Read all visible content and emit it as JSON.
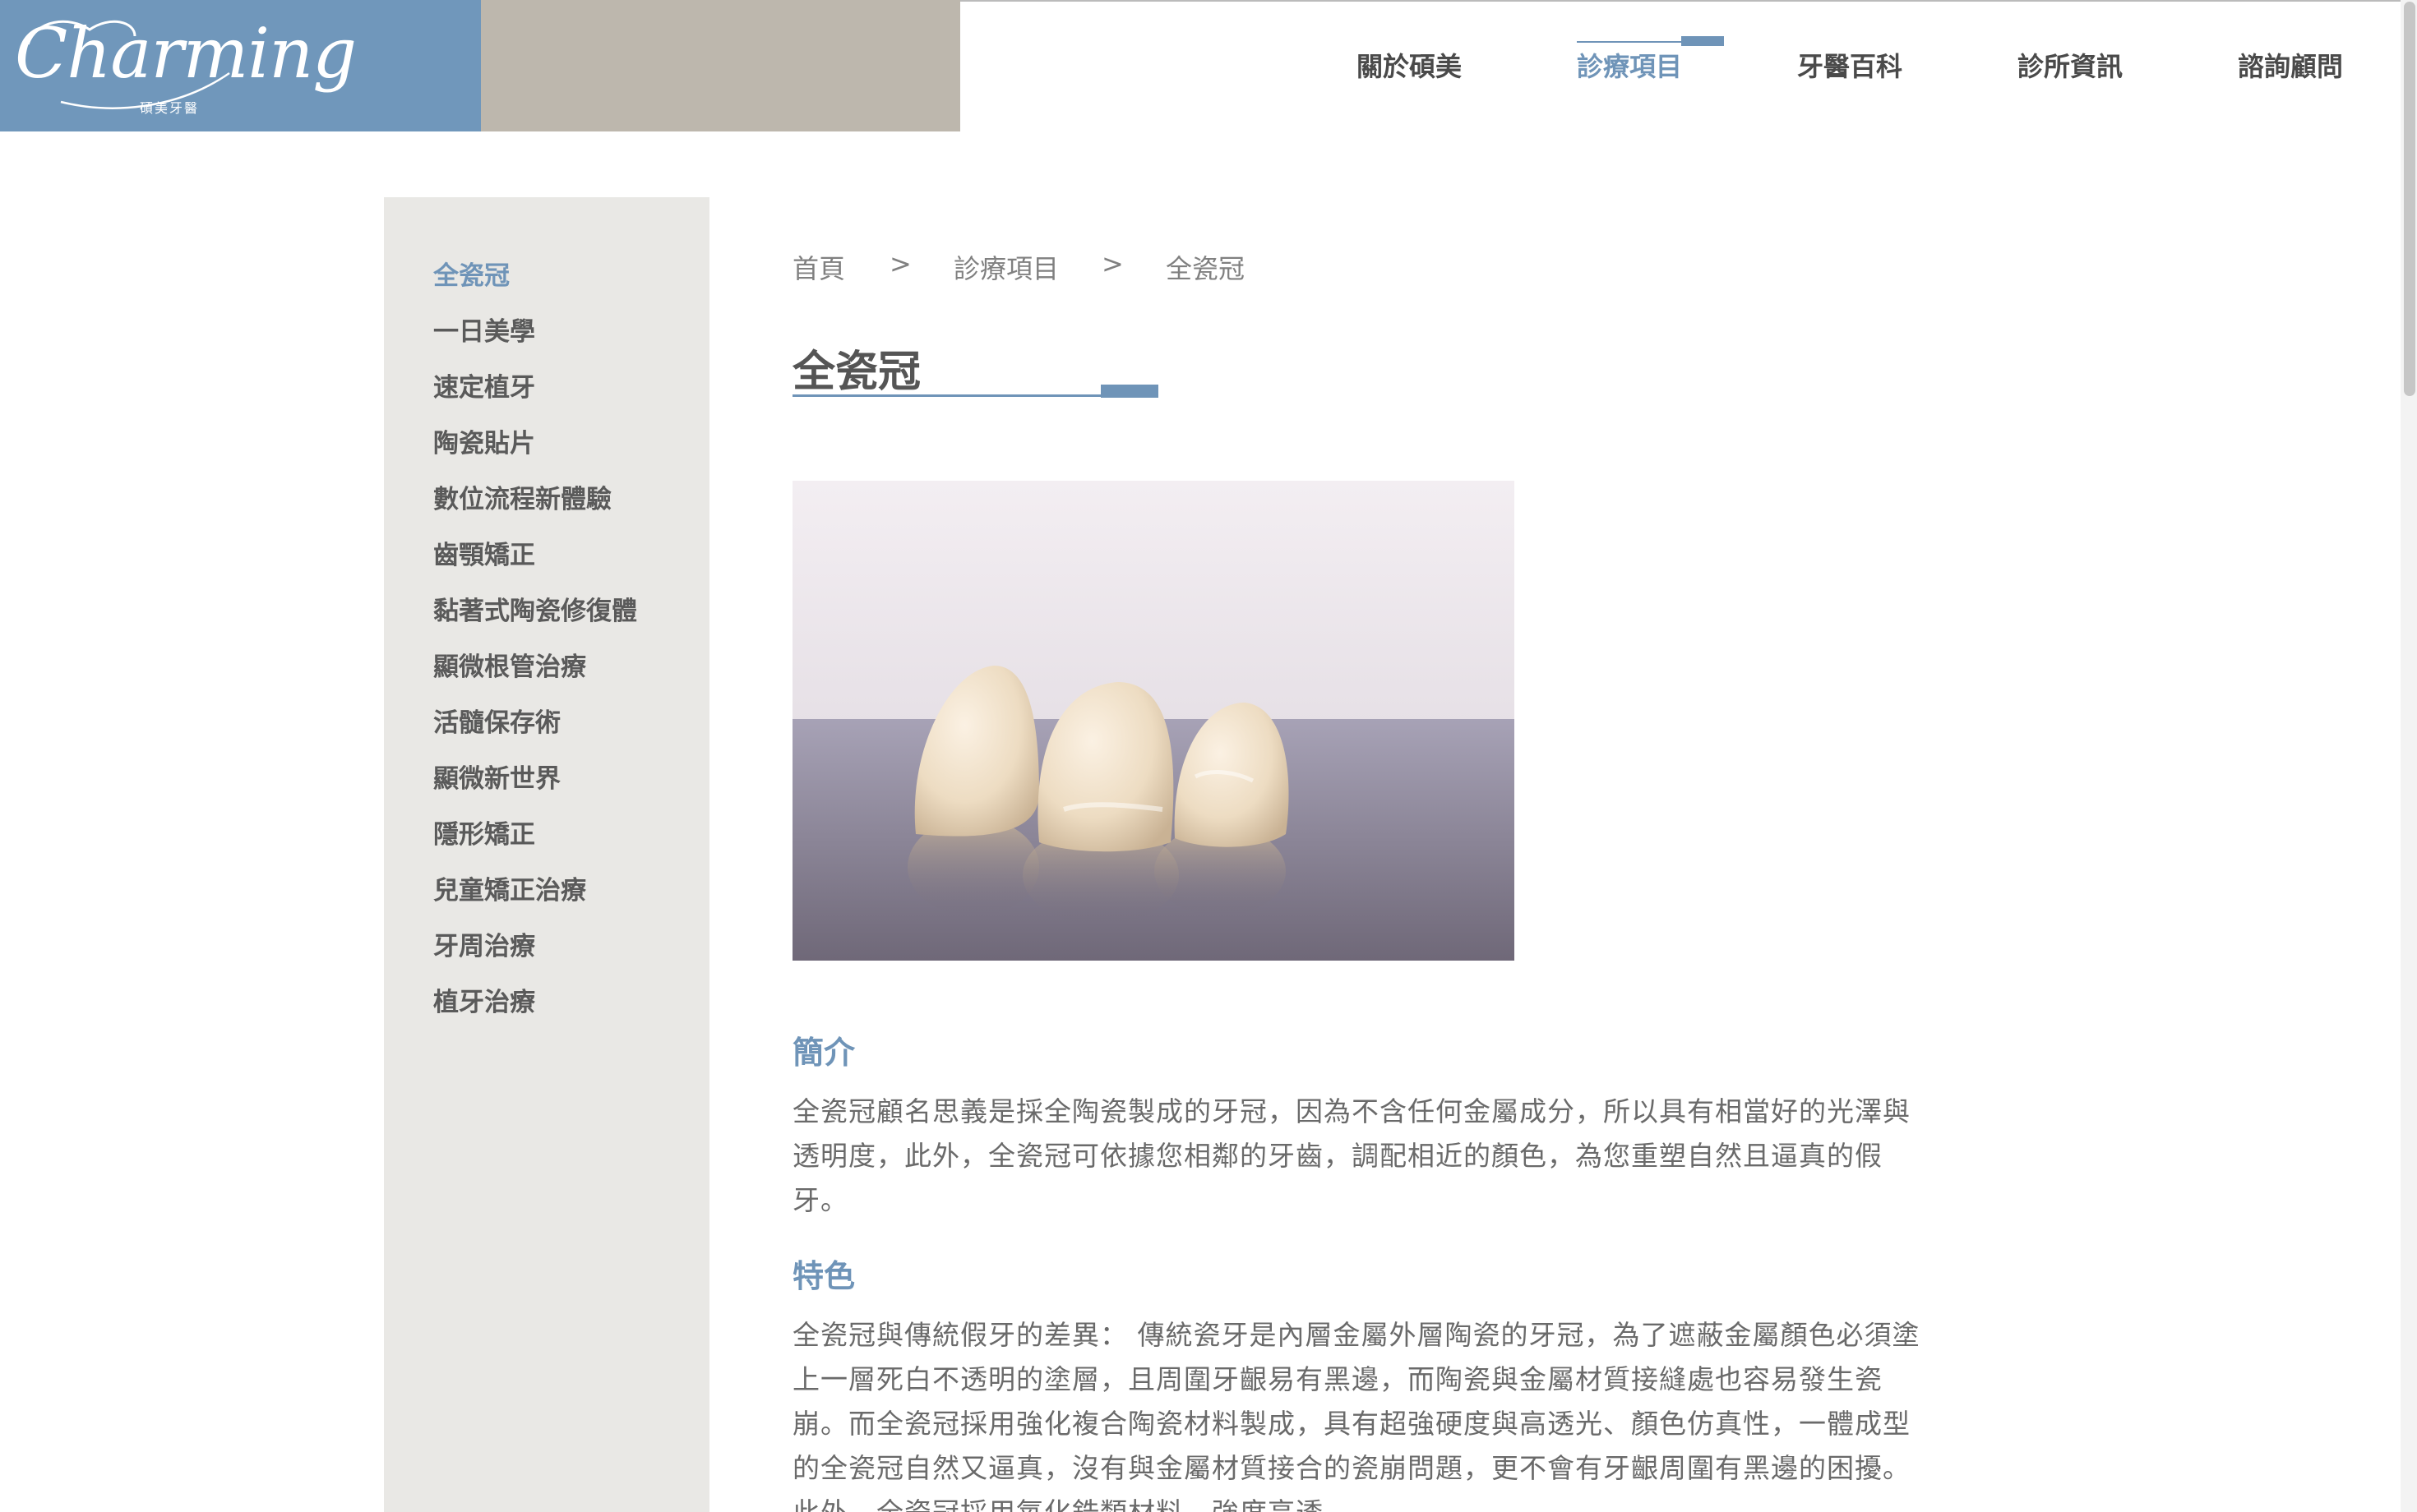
{
  "header": {
    "logo_text": "Charming",
    "logo_subtext": "碩美牙醫",
    "nav": [
      {
        "label": "關於碩美",
        "active": false
      },
      {
        "label": "診療項目",
        "active": true
      },
      {
        "label": "牙醫百科",
        "active": false
      },
      {
        "label": "診所資訊",
        "active": false
      },
      {
        "label": "諮詢顧問",
        "active": false
      }
    ]
  },
  "sidebar": {
    "items": [
      {
        "label": "全瓷冠",
        "active": true
      },
      {
        "label": "一日美學"
      },
      {
        "label": "速定植牙"
      },
      {
        "label": "陶瓷貼片"
      },
      {
        "label": "數位流程新體驗"
      },
      {
        "label": "齒顎矯正"
      },
      {
        "label": "黏著式陶瓷修復體"
      },
      {
        "label": "顯微根管治療"
      },
      {
        "label": "活髓保存術"
      },
      {
        "label": "顯微新世界"
      },
      {
        "label": "隱形矯正"
      },
      {
        "label": "兒童矯正治療"
      },
      {
        "label": "牙周治療"
      },
      {
        "label": "植牙治療"
      }
    ]
  },
  "breadcrumb": {
    "items": [
      "首頁",
      "診療項目",
      "全瓷冠"
    ],
    "separator": ">"
  },
  "main": {
    "title": "全瓷冠",
    "sections": [
      {
        "heading": "簡介",
        "text": "全瓷冠顧名思義是採全陶瓷製成的牙冠，因為不含任何金屬成分，所以具有相當好的光澤與透明度，此外，全瓷冠可依據您相鄰的牙齒，調配相近的顏色，為您重塑自然且逼真的假牙。"
      },
      {
        "heading": "特色",
        "text": "全瓷冠與傳統假牙的差異： 傳統瓷牙是內層金屬外層陶瓷的牙冠，為了遮蔽金屬顏色必須塗上一層死白不透明的塗層，且周圍牙齦易有黑邊，而陶瓷與金屬材質接縫處也容易發生瓷崩。而全瓷冠採用強化複合陶瓷材料製成，具有超強硬度與高透光、顏色仿真性，一體成型的全瓷冠自然又逼真，沒有與金屬材質接合的瓷崩問題，更不會有牙齦周圍有黑邊的困擾。此外，全瓷冠採用氧化鋯類材料，強度高透"
      }
    ]
  },
  "colors": {
    "accent": "#6f94b8",
    "logo_bg": "#7097bb",
    "taupe": "#bdb7ad",
    "sidebar_bg": "#e9e8e5"
  }
}
